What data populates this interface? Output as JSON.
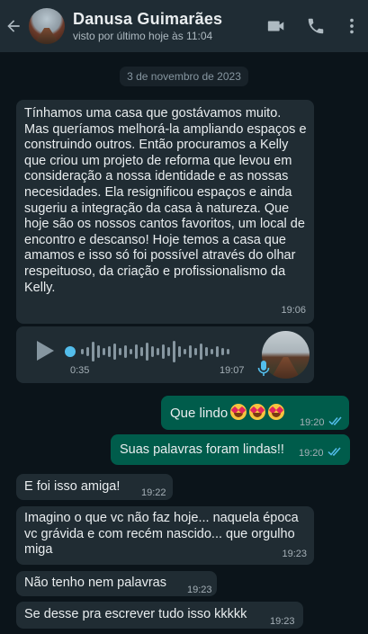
{
  "header": {
    "contact_name": "Danusa Guimarães",
    "last_seen": "visto por último hoje às 11:04",
    "icons": [
      "back-arrow-icon",
      "video-call-icon",
      "phone-icon",
      "more-options-icon"
    ]
  },
  "date_chip": "3 de novembro de 2023",
  "messages": [
    {
      "direction": "incoming",
      "text": "Tínhamos uma casa que gostávamos muito. Mas queríamos melhorá-la ampliando espaços e construindo outros. Então procuramos a Kelly que criou um projeto de reforma que levou em consideração a nossa identidade e as nossas necesidades. Ela resignificou espaços e ainda sugeriu a integração da casa à natureza. Que hoje são os nossos cantos favoritos, um local de encontro e descanso! Hoje temos a casa que amamos e isso só foi possível através do olhar respeituoso, da criação e profissionalismo da Kelly.",
      "time": "19:06"
    },
    {
      "direction": "incoming",
      "type": "voice",
      "duration": "0:35",
      "time": "19:07"
    },
    {
      "direction": "outgoing",
      "text": "Que lindo",
      "emoji_count": 3,
      "time": "19:20",
      "status": "read"
    },
    {
      "direction": "outgoing",
      "text": "Suas palavras foram lindas!!",
      "time": "19:20",
      "status": "read"
    },
    {
      "direction": "incoming",
      "text": "E foi isso amiga!",
      "time": "19:22"
    },
    {
      "direction": "incoming",
      "text": "Imagino o que vc não faz hoje... naquela época vc grávida e com recém nascido... que orgulho miga",
      "time": "19:23"
    },
    {
      "direction": "incoming",
      "text": "Não tenho nem palavras",
      "time": "19:23"
    },
    {
      "direction": "incoming",
      "text": "Se desse pra escrever tudo isso kkkkk",
      "time": "19:23"
    }
  ],
  "colors": {
    "background": "#0b141a",
    "header": "#1f2c34",
    "incoming_bubble": "#202c33",
    "outgoing_bubble": "#005c4b",
    "read_ticks": "#53bdeb",
    "voice_mic": "#53bdeb"
  }
}
